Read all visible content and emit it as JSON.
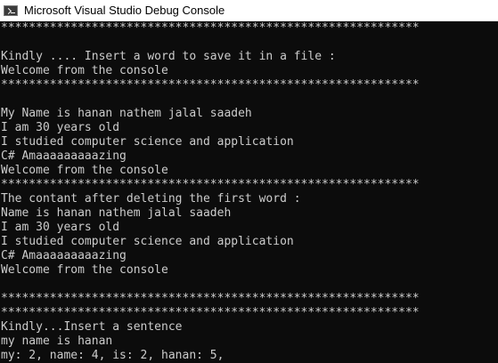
{
  "window": {
    "title": "Microsoft Visual Studio Debug Console",
    "icon": "console-app-icon"
  },
  "console": {
    "lines": [
      "************************************************************",
      "",
      "Kindly .... Insert a word to save it in a file :",
      "Welcome from the console",
      "************************************************************",
      "",
      "My Name is hanan nathem jalal saadeh",
      "I am 30 years old",
      "I studied computer science and application",
      "C# Amaaaaaaaaazing",
      "Welcome from the console",
      "************************************************************",
      "The contant after deleting the first word :",
      "Name is hanan nathem jalal saadeh",
      "I am 30 years old",
      "I studied computer science and application",
      "C# Amaaaaaaaaazing",
      "Welcome from the console",
      "",
      "************************************************************",
      "************************************************************",
      "Kindly...Insert a sentence",
      "my name is hanan",
      "my: 2, name: 4, is: 2, hanan: 5,",
      "************************************************************"
    ]
  }
}
